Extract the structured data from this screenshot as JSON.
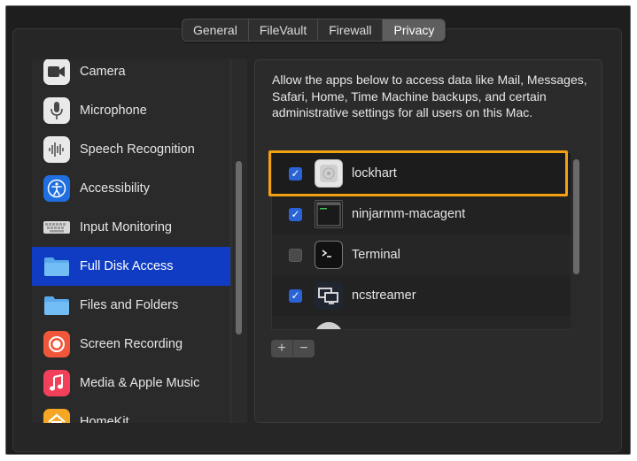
{
  "tabs": [
    {
      "label": "General",
      "active": false
    },
    {
      "label": "FileVault",
      "active": false
    },
    {
      "label": "Firewall",
      "active": false
    },
    {
      "label": "Privacy",
      "active": true
    }
  ],
  "sidebar": {
    "items": [
      {
        "label": "Camera",
        "icon": "camera-icon",
        "selected": false
      },
      {
        "label": "Microphone",
        "icon": "microphone-icon",
        "selected": false
      },
      {
        "label": "Speech Recognition",
        "icon": "waveform-icon",
        "selected": false
      },
      {
        "label": "Accessibility",
        "icon": "accessibility-icon",
        "selected": false
      },
      {
        "label": "Input Monitoring",
        "icon": "keyboard-icon",
        "selected": false
      },
      {
        "label": "Full Disk Access",
        "icon": "folder-icon",
        "selected": true
      },
      {
        "label": "Files and Folders",
        "icon": "folder-icon",
        "selected": false
      },
      {
        "label": "Screen Recording",
        "icon": "record-icon",
        "selected": false
      },
      {
        "label": "Media & Apple Music",
        "icon": "music-note-icon",
        "selected": false
      },
      {
        "label": "HomeKit",
        "icon": "home-icon",
        "selected": false
      }
    ]
  },
  "main": {
    "description": "Allow the apps below to access data like Mail, Messages, Safari, Home, Time Machine backups, and certain administrative settings for all users on this Mac.",
    "apps": [
      {
        "name": "lockhart",
        "checked": true,
        "icon": "lockhart-app-icon"
      },
      {
        "name": "ninjarmm-macagent",
        "checked": true,
        "icon": "terminal-exec-icon"
      },
      {
        "name": "Terminal",
        "checked": false,
        "icon": "terminal-icon"
      },
      {
        "name": "ncstreamer",
        "checked": true,
        "icon": "screens-icon"
      }
    ],
    "add_label": "+",
    "remove_label": "−"
  },
  "colors": {
    "selection": "#0f3cc2",
    "checkbox": "#2a63d6",
    "highlight": "#f3a012"
  }
}
